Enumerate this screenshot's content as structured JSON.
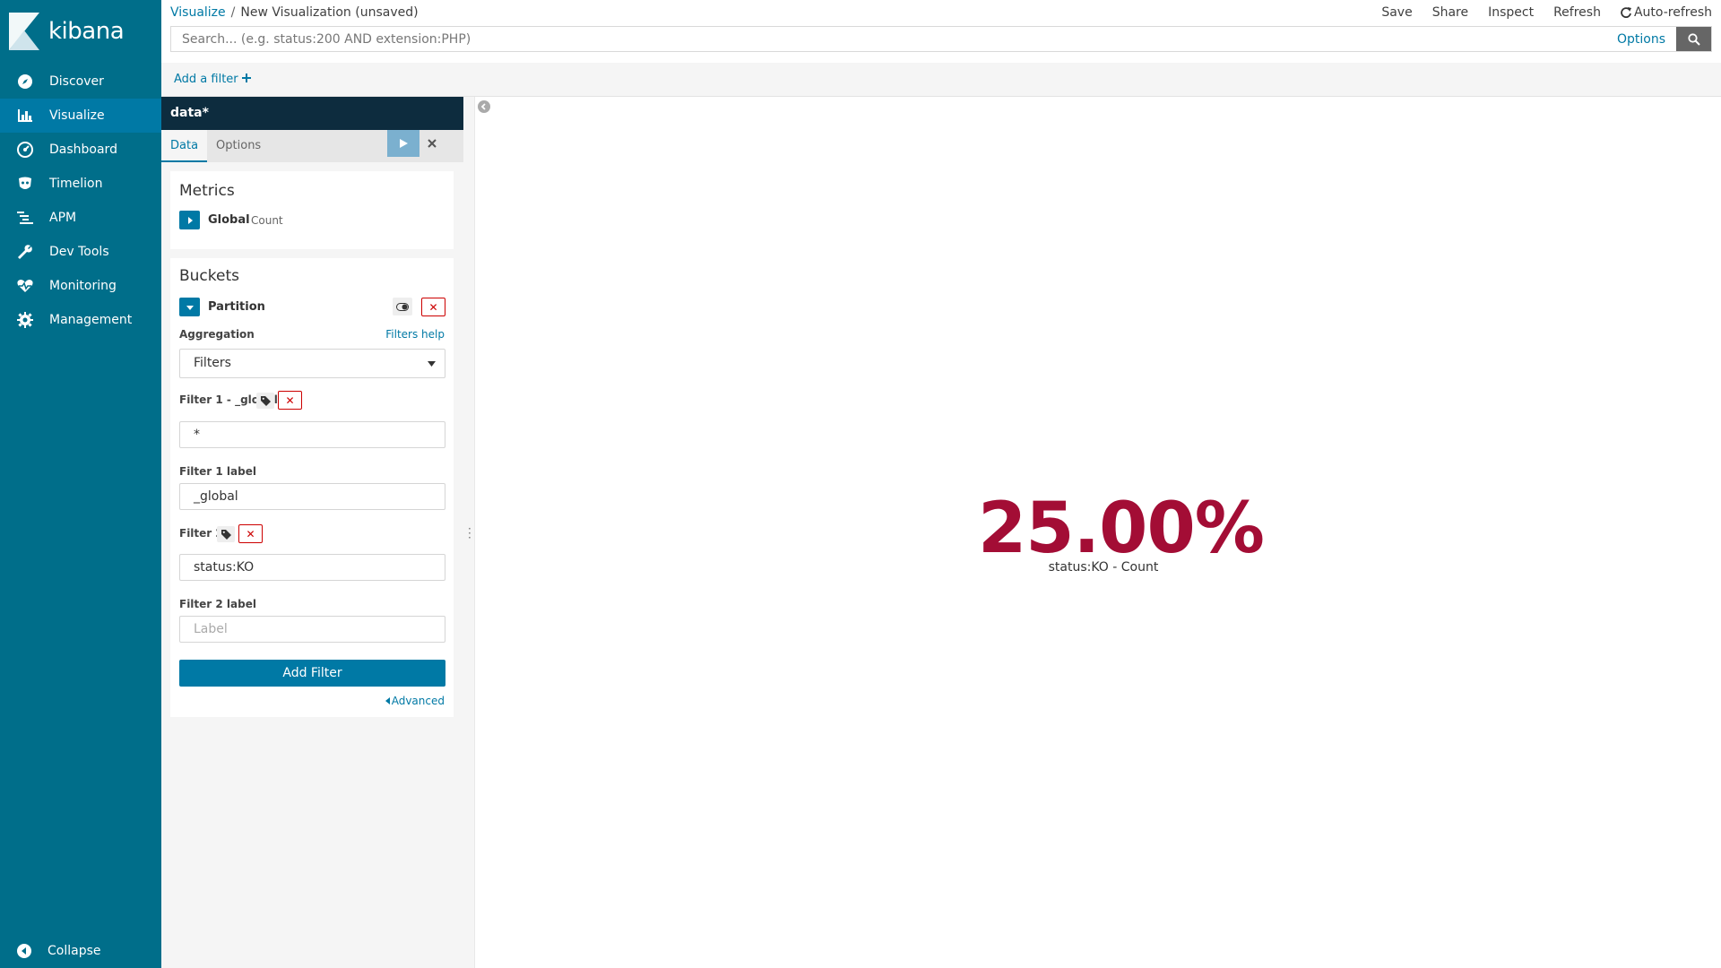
{
  "app": {
    "logo_text": "kibana"
  },
  "sidebar": {
    "items": [
      {
        "label": "Discover",
        "icon": "compass-icon"
      },
      {
        "label": "Visualize",
        "icon": "bar-chart-icon",
        "active": true
      },
      {
        "label": "Dashboard",
        "icon": "dashboard-icon"
      },
      {
        "label": "Timelion",
        "icon": "timelion-icon"
      },
      {
        "label": "APM",
        "icon": "apm-icon"
      },
      {
        "label": "Dev Tools",
        "icon": "wrench-icon"
      },
      {
        "label": "Monitoring",
        "icon": "heartbeat-icon"
      },
      {
        "label": "Management",
        "icon": "gear-icon"
      }
    ],
    "collapse_label": "Collapse"
  },
  "header": {
    "breadcrumb_root": "Visualize",
    "breadcrumb_sep": "/",
    "breadcrumb_current": "New Visualization (unsaved)",
    "menu": {
      "save": "Save",
      "share": "Share",
      "inspect": "Inspect",
      "refresh": "Refresh",
      "auto_refresh": "Auto-refresh"
    },
    "search_placeholder": "Search... (e.g. status:200 AND extension:PHP)",
    "options_label": "Options"
  },
  "filterbar": {
    "add_filter": "Add a filter"
  },
  "editor": {
    "title": "data*",
    "tabs": [
      "Data",
      "Options"
    ],
    "metrics": {
      "heading": "Metrics",
      "agg_label": "Global",
      "agg_type": "Count"
    },
    "buckets": {
      "heading": "Buckets",
      "bucket_label": "Partition",
      "aggregation_label": "Aggregation",
      "filters_help": "Filters help",
      "aggregation_value": "Filters",
      "filter1_label": "Filter 1 - _global",
      "filter1_value": "*",
      "filter1_label_label": "Filter 1 label",
      "filter1_label_value": "_global",
      "filter2_label": "Filter 2",
      "filter2_value": "status:KO",
      "filter2_label_label": "Filter 2 label",
      "filter2_label_placeholder": "Label",
      "add_filter_button": "Add Filter",
      "advanced_link": "Advanced"
    }
  },
  "visualization": {
    "value": "25.00%",
    "label": "status:KO - Count",
    "value_color": "#a30d35"
  },
  "colors": {
    "sidebar": "#006e8a",
    "sidebar_active": "#0079a5",
    "accent": "#0079a5",
    "editor_title": "#0d2c3e"
  }
}
